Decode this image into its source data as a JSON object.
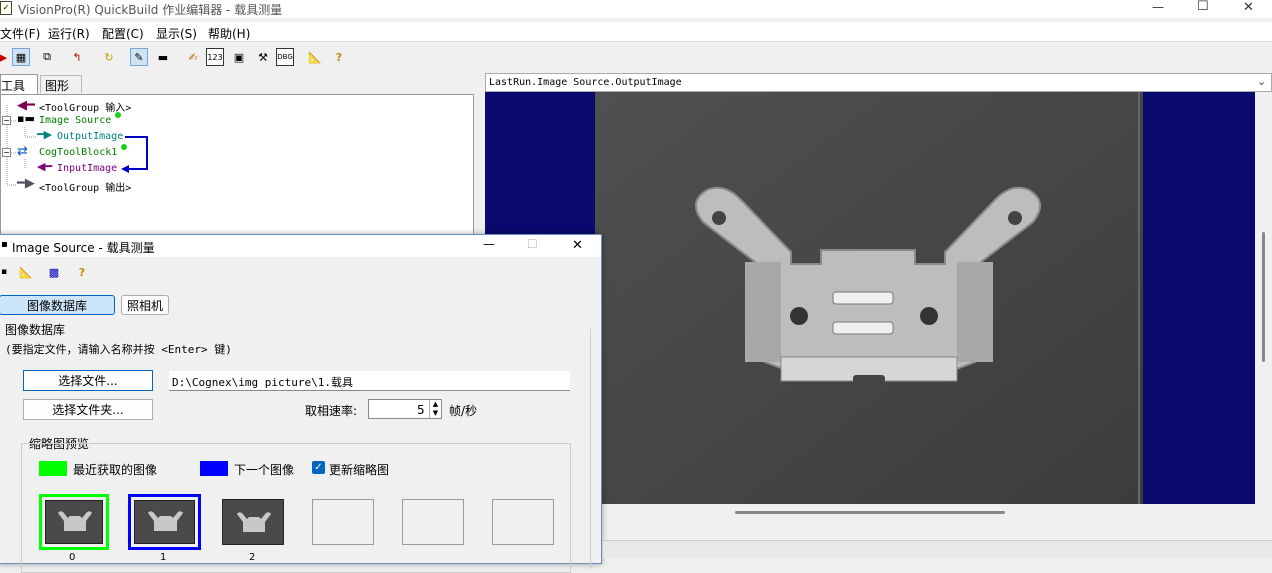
{
  "window": {
    "title": "VisionPro(R) QuickBuild 作业编辑器 - 载具测量",
    "minimize": "—",
    "maximize": "☐",
    "close": "✕"
  },
  "menu": [
    {
      "label": "文件(F)"
    },
    {
      "label": "运行(R)"
    },
    {
      "label": "配置(C)"
    },
    {
      "label": "显示(S)"
    },
    {
      "label": "帮助(H)"
    }
  ],
  "tabs": {
    "tools": "工具",
    "graphics": "图形"
  },
  "tree": [
    {
      "label": "<ToolGroup 输入>",
      "color": "#000000"
    },
    {
      "label": "Image Source",
      "color": "#008000"
    },
    {
      "label": "OutputImage",
      "color": "#008080"
    },
    {
      "label": "CogToolBlock1",
      "color": "#008000"
    },
    {
      "label": "InputImage",
      "color": "#800080"
    },
    {
      "label": "<ToolGroup 输出>",
      "color": "#000000"
    }
  ],
  "display_select": {
    "value": "LastRun.Image Source.OutputImage"
  },
  "dialog": {
    "title": "Image Source - 载具测量",
    "mode_tabs": {
      "database": "图像数据库",
      "camera": "照相机"
    },
    "group_title": "图像数据库",
    "hint": "(要指定文件，请输入名称并按 <Enter> 键)",
    "select_file_button": "选择文件...",
    "select_folder_button": "选择文件夹...",
    "file_path": "D:\\Cognex\\img picture\\1.载具",
    "rate_label": "取相速率:",
    "rate_value": "5",
    "rate_unit": "帧/秒",
    "preview_title": "缩略图预览",
    "legend_recent": "最近获取的图像",
    "legend_next": "下一个图像",
    "update_thumbs_label": "更新缩略图",
    "update_thumbs_checked": true,
    "thumb_labels": [
      "0",
      "1",
      "2"
    ]
  },
  "colors": {
    "recent": "#00ff00",
    "next": "#0000ff",
    "display_bg": "#0a0a6e",
    "image_bg": "#4a4a4a",
    "accent": "#0067c0"
  }
}
